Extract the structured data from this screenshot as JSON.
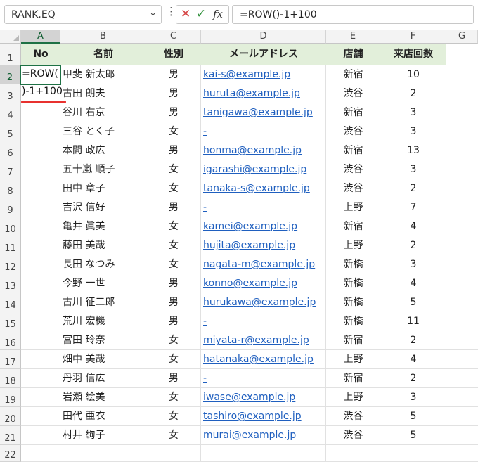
{
  "formula_bar": {
    "name_box": "RANK.EQ",
    "dropdown_icon": "chevron-down-icon",
    "more_icon": "vertical-dots-icon",
    "cancel_icon": "close-icon",
    "enter_icon": "checkmark-icon",
    "fx_label": "fx",
    "formula": "=ROW()-1+100"
  },
  "columns": [
    "A",
    "B",
    "C",
    "D",
    "E",
    "F",
    "G"
  ],
  "rows": [
    "1",
    "2",
    "3",
    "4",
    "5",
    "6",
    "7",
    "8",
    "9",
    "10",
    "11",
    "12",
    "13",
    "14",
    "15",
    "16",
    "17",
    "18",
    "19",
    "20",
    "21",
    "22"
  ],
  "header": [
    "No",
    "名前",
    "性別",
    "メールアドレス",
    "店舗",
    "来店回数"
  ],
  "editing": {
    "line1": "=ROW(",
    "line2": ")-1+100"
  },
  "records": [
    {
      "name": "甲斐 新太郎",
      "gender": "男",
      "email": "kai-s@example.jp",
      "store": "新宿",
      "visits": "10"
    },
    {
      "name": "古田 朗夫",
      "gender": "男",
      "email": "huruta@example.jp",
      "store": "渋谷",
      "visits": "2"
    },
    {
      "name": "谷川 右京",
      "gender": "男",
      "email": "tanigawa@example.jp",
      "store": "新宿",
      "visits": "3"
    },
    {
      "name": "三谷 とく子",
      "gender": "女",
      "email": "-",
      "store": "渋谷",
      "visits": "3"
    },
    {
      "name": "本間 政広",
      "gender": "男",
      "email": "honma@example.jp",
      "store": "新宿",
      "visits": "13"
    },
    {
      "name": "五十嵐 順子",
      "gender": "女",
      "email": "igarashi@example.jp",
      "store": "渋谷",
      "visits": "3"
    },
    {
      "name": "田中 章子",
      "gender": "女",
      "email": "tanaka-s@example.jp",
      "store": "渋谷",
      "visits": "2"
    },
    {
      "name": "吉沢 信好",
      "gender": "男",
      "email": "-",
      "store": "上野",
      "visits": "7"
    },
    {
      "name": "亀井 眞美",
      "gender": "女",
      "email": "kamei@example.jp",
      "store": "新宿",
      "visits": "4"
    },
    {
      "name": "藤田 美哉",
      "gender": "女",
      "email": "hujita@example.jp",
      "store": "上野",
      "visits": "2"
    },
    {
      "name": "長田 なつみ",
      "gender": "女",
      "email": "nagata-m@example.jp",
      "store": "新橋",
      "visits": "3"
    },
    {
      "name": "今野 一世",
      "gender": "男",
      "email": "konno@example.jp",
      "store": "新橋",
      "visits": "4"
    },
    {
      "name": "古川 征二郎",
      "gender": "男",
      "email": "hurukawa@example.jp",
      "store": "新橋",
      "visits": "5"
    },
    {
      "name": "荒川 宏機",
      "gender": "男",
      "email": "-",
      "store": "新橋",
      "visits": "11"
    },
    {
      "name": "宮田 玲奈",
      "gender": "女",
      "email": "miyata-r@example.jp",
      "store": "新宿",
      "visits": "2"
    },
    {
      "name": "畑中 美哉",
      "gender": "女",
      "email": "hatanaka@example.jp",
      "store": "上野",
      "visits": "4"
    },
    {
      "name": "丹羽 信広",
      "gender": "男",
      "email": "-",
      "store": "新宿",
      "visits": "2"
    },
    {
      "name": "岩瀬 絵美",
      "gender": "女",
      "email": "iwase@example.jp",
      "store": "上野",
      "visits": "3"
    },
    {
      "name": "田代 亜衣",
      "gender": "女",
      "email": "tashiro@example.jp",
      "store": "渋谷",
      "visits": "5"
    },
    {
      "name": "村井 絢子",
      "gender": "女",
      "email": "murai@example.jp",
      "store": "渋谷",
      "visits": "5"
    }
  ],
  "colors": {
    "header_fill": "#e2efda",
    "selection": "#1e7145",
    "link": "#1f5fbf",
    "annotation": "#e8312f"
  }
}
